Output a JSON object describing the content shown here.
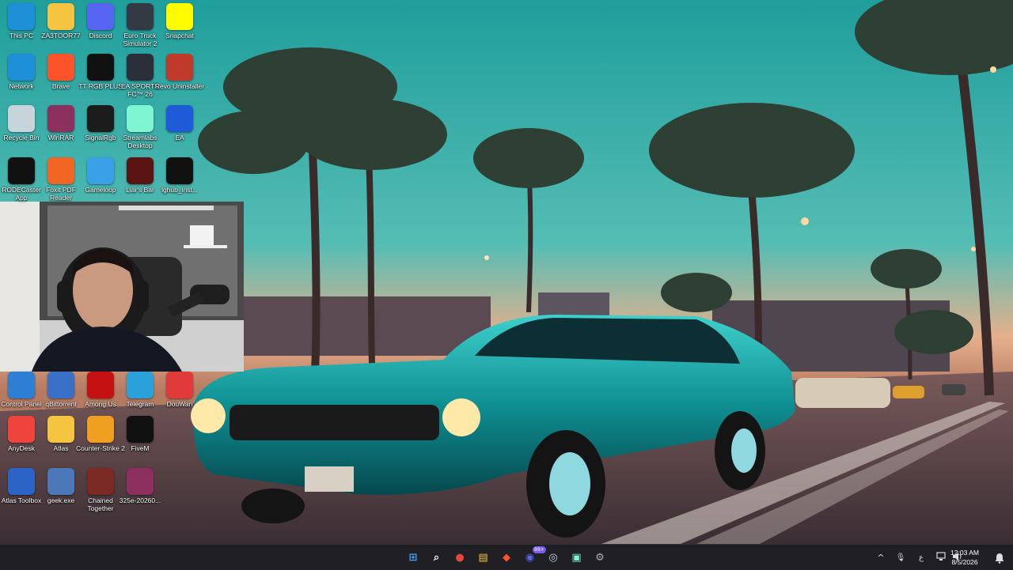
{
  "desktop": {
    "icons": [
      {
        "label": "This PC",
        "icon": "monitor-icon",
        "color": "#1e90d8"
      },
      {
        "label": "ZA3TOOR77",
        "icon": "folder-icon",
        "color": "#f5c542"
      },
      {
        "label": "Discord",
        "icon": "discord-icon",
        "color": "#5865f2"
      },
      {
        "label": "Euro Truck Simulator 2",
        "icon": "truck-icon",
        "color": "#333a44"
      },
      {
        "label": "Snapchat",
        "icon": "snapchat-icon",
        "color": "#fffc00"
      },
      {
        "label": "Network",
        "icon": "network-icon",
        "color": "#1e90d8"
      },
      {
        "label": "Brave",
        "icon": "brave-icon",
        "color": "#fb542b"
      },
      {
        "label": "TT RGB PLUS",
        "icon": "tt-icon",
        "color": "#111111"
      },
      {
        "label": "EA SPORTS FC™ 26",
        "icon": "fc-icon",
        "color": "#2a2f3a"
      },
      {
        "label": "Revo Uninstaller",
        "icon": "revo-icon",
        "color": "#c03a2b"
      },
      {
        "label": "Recycle Bin",
        "icon": "recycle-bin-icon",
        "color": "#c8d4dc"
      },
      {
        "label": "WinRAR",
        "icon": "winrar-icon",
        "color": "#8b2f5f"
      },
      {
        "label": "SignalRgb",
        "icon": "signalrgb-icon",
        "color": "#1c1c1c"
      },
      {
        "label": "Streamlabs Desktop",
        "icon": "streamlabs-icon",
        "color": "#80f5d2"
      },
      {
        "label": "EA",
        "icon": "ea-icon",
        "color": "#1f5bd8"
      },
      {
        "label": "RODECaster App",
        "icon": "rode-icon",
        "color": "#111111"
      },
      {
        "label": "Foxit PDF Reader",
        "icon": "foxit-icon",
        "color": "#f26522"
      },
      {
        "label": "Gameloop",
        "icon": "gameloop-icon",
        "color": "#3aa0e8"
      },
      {
        "label": "Liar's Bar",
        "icon": "liarsbar-icon",
        "color": "#5a1414"
      },
      {
        "label": "lghub_inst...",
        "icon": "lghub-icon",
        "color": "#111111"
      },
      {
        "label": "Control Panel",
        "icon": "control-panel-icon",
        "color": "#2d7fd3"
      },
      {
        "label": "qBittorrent",
        "icon": "qbittorrent-icon",
        "color": "#3a6fc8"
      },
      {
        "label": "Among Us",
        "icon": "amongus-icon",
        "color": "#c51111"
      },
      {
        "label": "Telegram",
        "icon": "telegram-icon",
        "color": "#2aa1db"
      },
      {
        "label": "DouWan",
        "icon": "douwan-icon",
        "color": "#e03a3a"
      },
      {
        "label": "AnyDesk",
        "icon": "anydesk-icon",
        "color": "#ef443b"
      },
      {
        "label": "Atlas",
        "icon": "folder-icon",
        "color": "#f5c542"
      },
      {
        "label": "Counter-Strike 2",
        "icon": "cs2-icon",
        "color": "#f0a020"
      },
      {
        "label": "FiveM",
        "icon": "fivem-icon",
        "color": "#111111"
      },
      {
        "label": "Atlas Toolbox",
        "icon": "atlas-toolbox-icon",
        "color": "#2b64c6"
      },
      {
        "label": "geek.exe",
        "icon": "geek-icon",
        "color": "#4a78b8"
      },
      {
        "label": "Chained Together",
        "icon": "chained-icon",
        "color": "#7a2a22"
      },
      {
        "label": "325e-20260...",
        "icon": "winrar-icon",
        "color": "#8b2f5f"
      }
    ]
  },
  "taskbar": {
    "apps": [
      {
        "name": "start-button",
        "glyph": "⊞",
        "color": "#3ea6ff"
      },
      {
        "name": "search-icon",
        "glyph": "⌕",
        "color": "#ffffff"
      },
      {
        "name": "chrome-icon",
        "glyph": "●",
        "color": "#e8453c"
      },
      {
        "name": "file-explorer-icon",
        "glyph": "▤",
        "color": "#f5c542"
      },
      {
        "name": "brave-icon",
        "glyph": "◆",
        "color": "#fb542b"
      },
      {
        "name": "discord-icon",
        "glyph": "◉",
        "color": "#5865f2"
      },
      {
        "name": "steam-icon",
        "glyph": "◎",
        "color": "#c7d5e0"
      },
      {
        "name": "streamlabs-icon",
        "glyph": "▣",
        "color": "#80f5d2"
      },
      {
        "name": "settings-icon",
        "glyph": "⚙",
        "color": "#b0b0b0"
      }
    ],
    "discord_badge": "99+",
    "tray": {
      "chevron": "^",
      "mic": "🎙",
      "lang": "ع",
      "time": "12:03 AM",
      "date": "8/5/2026"
    }
  }
}
